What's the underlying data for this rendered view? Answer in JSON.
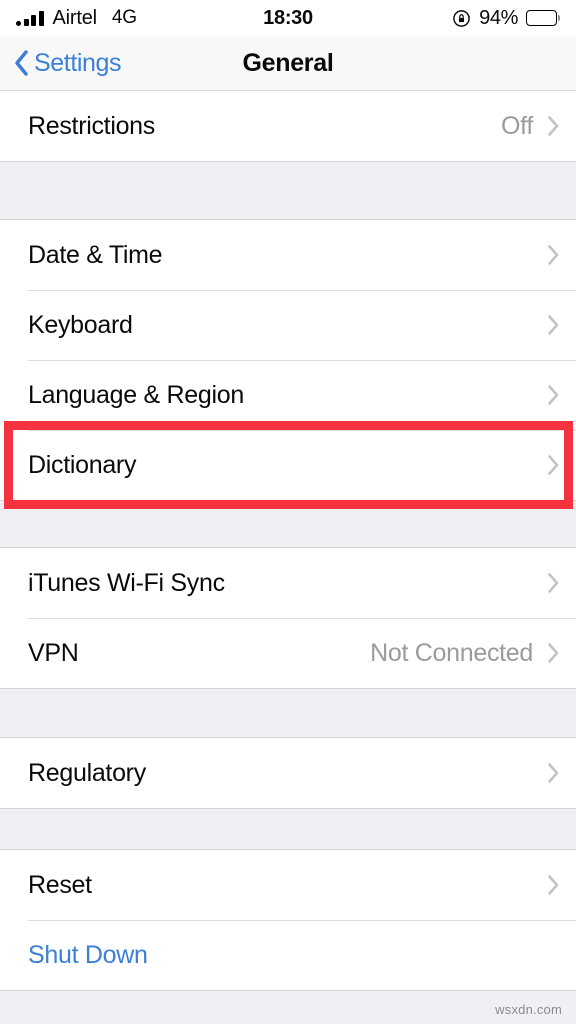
{
  "status_bar": {
    "carrier": "Airtel",
    "network": "4G",
    "time": "18:30",
    "battery_percent": "94%",
    "signal_bars": 4,
    "rotation_lock_icon": "rotation-lock-icon",
    "battery_icon": "battery-icon"
  },
  "nav": {
    "back_label": "Settings",
    "title": "General",
    "back_icon": "chevron-left-icon",
    "accent_color": "#3C7FD4"
  },
  "sections": [
    {
      "id": "restrictions",
      "rows": [
        {
          "label": "Restrictions",
          "value": "Off",
          "chevron": true,
          "style": "default"
        }
      ]
    },
    {
      "id": "datetime-keyboard-language-dictionary",
      "rows": [
        {
          "label": "Date & Time",
          "value": "",
          "chevron": true,
          "style": "default"
        },
        {
          "label": "Keyboard",
          "value": "",
          "chevron": true,
          "style": "default"
        },
        {
          "label": "Language & Region",
          "value": "",
          "chevron": true,
          "style": "default"
        },
        {
          "label": "Dictionary",
          "value": "",
          "chevron": true,
          "style": "default"
        }
      ]
    },
    {
      "id": "sync-vpn",
      "rows": [
        {
          "label": "iTunes Wi-Fi Sync",
          "value": "",
          "chevron": true,
          "style": "default"
        },
        {
          "label": "VPN",
          "value": "Not Connected",
          "chevron": true,
          "style": "default"
        }
      ]
    },
    {
      "id": "regulatory",
      "rows": [
        {
          "label": "Regulatory",
          "value": "",
          "chevron": true,
          "style": "default"
        }
      ]
    },
    {
      "id": "reset-shutdown",
      "rows": [
        {
          "label": "Reset",
          "value": "",
          "chevron": true,
          "style": "default"
        },
        {
          "label": "Shut Down",
          "value": "",
          "chevron": false,
          "style": "link"
        }
      ]
    }
  ],
  "highlight": {
    "target_label": "Dictionary",
    "color": "#F5333F"
  },
  "watermark": {
    "text": "wsxdn.com"
  }
}
